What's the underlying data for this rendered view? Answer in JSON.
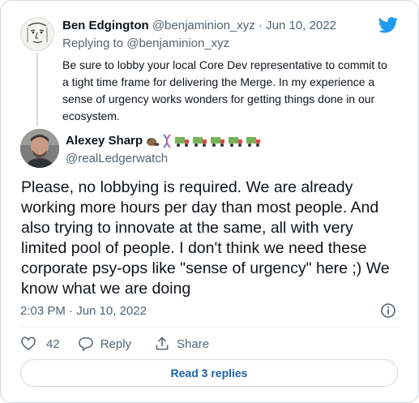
{
  "colors": {
    "twitter_blue": "#1d9bf0",
    "text": "#0f1419",
    "muted": "#536471",
    "link": "#1b62a8"
  },
  "parent_tweet": {
    "author_name": "Ben Edgington",
    "author_handle": "@benjaminion_xyz",
    "separator": "·",
    "date": "Jun 10, 2022",
    "replying_prefix": "Replying to",
    "replying_to": "@benjaminion_xyz",
    "text": "Be sure to lobby your local Core Dev representative to commit to a tight time frame for delivering the Merge. In my experience a sense of urgency works wonders for getting things done in our ecosystem."
  },
  "main_tweet": {
    "author_name": "Alexey Sharp",
    "author_handle": "@realLedgerwatch",
    "name_emojis": [
      "beaver-icon",
      "dna-icon",
      "truck-icon",
      "truck-icon",
      "truck-icon",
      "truck-icon",
      "truck-icon"
    ],
    "text": "Please, no lobbying is required. We are already working more hours per day than most people. And also trying to innovate at the same, all with very limited pool of people. I don't think we need these corporate psy-ops like \"sense of urgency\" here ;) We know what we are doing",
    "timestamp": "2:03 PM · Jun 10, 2022",
    "likes": "42",
    "reply_label": "Reply",
    "share_label": "Share"
  },
  "read_replies_label": "Read 3 replies"
}
